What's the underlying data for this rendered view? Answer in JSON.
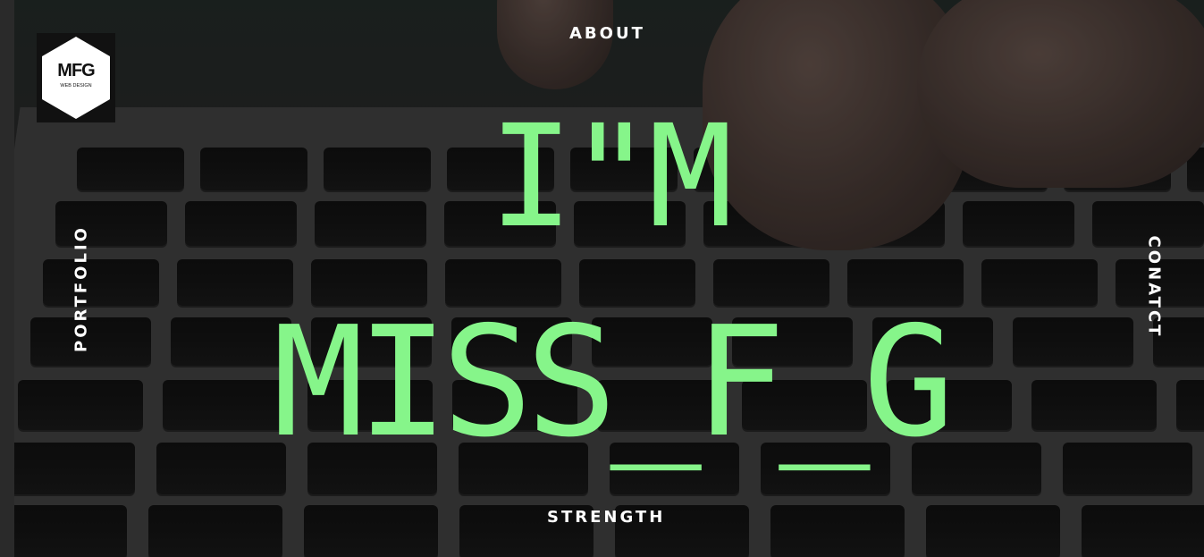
{
  "logo": {
    "mark": "MFG",
    "subtitle": "WEB DESIGN"
  },
  "nav": {
    "about": "ABOUT",
    "portfolio": "PORTFOLIO",
    "contact": "CONATCT",
    "strength": "STRENGTH"
  },
  "hero": {
    "line1": "I\"M",
    "line2": "MISS_F_G"
  },
  "colors": {
    "headline": "#86f58a",
    "nav_text": "#ffffff",
    "logo_bg": "#111111"
  },
  "icons": {
    "logo": "hexagon-logo-icon"
  }
}
